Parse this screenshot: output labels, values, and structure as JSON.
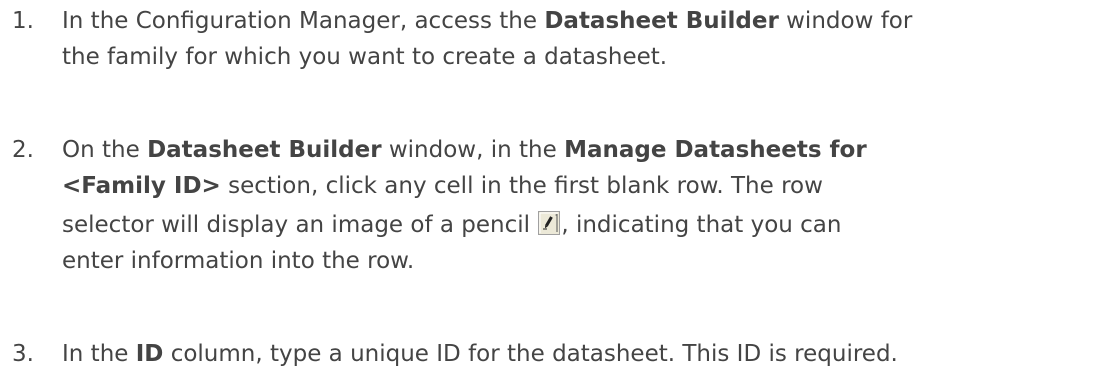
{
  "steps": [
    {
      "number": "1.",
      "line1": {
        "t1": "In the Configuration Manager, access the ",
        "b1": "Datasheet Builder",
        "t2": " window for"
      },
      "line2": "the family for which you want to create a datasheet."
    },
    {
      "number": "2.",
      "line1": {
        "t1": "On the ",
        "b1": "Datasheet Builder",
        "t2": " window, in the ",
        "b2": "Manage Datasheets for"
      },
      "line2": {
        "b1": "<Family ID>",
        "t1": " section, click any cell in the first blank row. The row"
      },
      "line3": {
        "t1": "selector will display an image of a pencil ",
        "icon": "pencil-row-selector-icon",
        "t2": ", indicating that you can"
      },
      "line4": "enter information into the row."
    },
    {
      "number": "3.",
      "line1": {
        "t1": "In the ",
        "b1": "ID",
        "t2": " column, type a unique ID for the datasheet. This ID is required."
      }
    }
  ]
}
